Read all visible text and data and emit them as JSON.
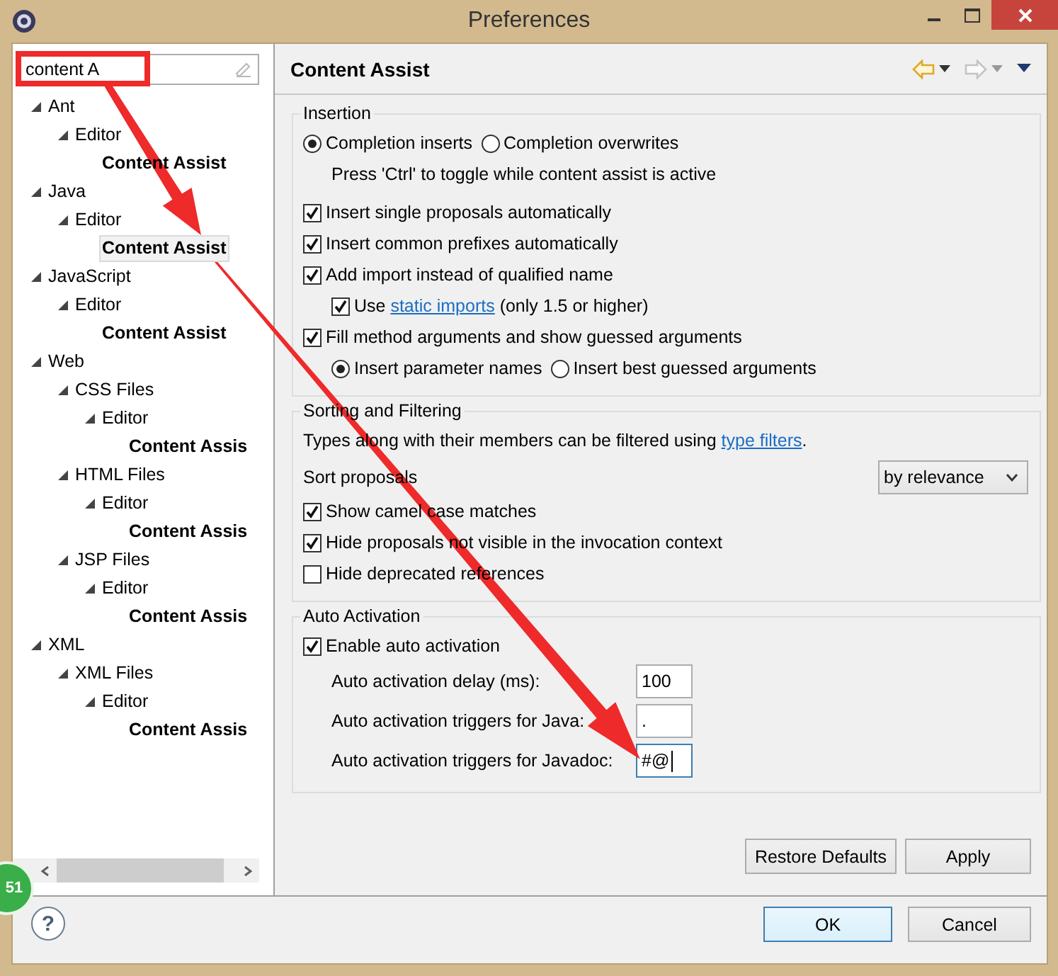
{
  "window": {
    "title": "Preferences"
  },
  "filter": {
    "value": "content A"
  },
  "tree": [
    {
      "label": "Ant",
      "expanded": true,
      "children": [
        {
          "label": "Editor",
          "expanded": true,
          "children": [
            {
              "label": "Content Assist",
              "selected": false
            }
          ]
        }
      ]
    },
    {
      "label": "Java",
      "expanded": true,
      "children": [
        {
          "label": "Editor",
          "expanded": true,
          "children": [
            {
              "label": "Content Assist",
              "selected": true
            }
          ]
        }
      ]
    },
    {
      "label": "JavaScript",
      "expanded": true,
      "children": [
        {
          "label": "Editor",
          "expanded": true,
          "children": [
            {
              "label": "Content Assist",
              "selected": false
            }
          ]
        }
      ]
    },
    {
      "label": "Web",
      "expanded": true,
      "children": [
        {
          "label": "CSS Files",
          "expanded": true,
          "children": [
            {
              "label": "Editor",
              "expanded": true,
              "children": [
                {
                  "label": "Content Assis",
                  "selected": false
                }
              ]
            }
          ]
        },
        {
          "label": "HTML Files",
          "expanded": true,
          "children": [
            {
              "label": "Editor",
              "expanded": true,
              "children": [
                {
                  "label": "Content Assis",
                  "selected": false
                }
              ]
            }
          ]
        },
        {
          "label": "JSP Files",
          "expanded": true,
          "children": [
            {
              "label": "Editor",
              "expanded": true,
              "children": [
                {
                  "label": "Content Assis",
                  "selected": false
                }
              ]
            }
          ]
        }
      ]
    },
    {
      "label": "XML",
      "expanded": true,
      "children": [
        {
          "label": "XML Files",
          "expanded": true,
          "children": [
            {
              "label": "Editor",
              "expanded": true,
              "children": [
                {
                  "label": "Content Assis",
                  "selected": false
                }
              ]
            }
          ]
        }
      ]
    }
  ],
  "page": {
    "title": "Content Assist",
    "back": {
      "enabled": true
    },
    "forward": {
      "enabled": false
    }
  },
  "groups": [
    {
      "title": "Insertion",
      "items": [
        {
          "kind": "radio-group",
          "options": [
            {
              "label": "Completion inserts",
              "selected": true
            },
            {
              "label": "Completion overwrites",
              "selected": false
            }
          ]
        },
        {
          "kind": "note",
          "parts": [
            {
              "text": "Press 'Ctrl' to toggle while content assist is active"
            }
          ]
        },
        {
          "kind": "checkbox",
          "parts": [
            {
              "text": "Insert single proposals automatically"
            }
          ],
          "checked": true
        },
        {
          "kind": "checkbox",
          "parts": [
            {
              "text": "Insert common prefixes automatically"
            }
          ],
          "checked": true
        },
        {
          "kind": "checkbox",
          "parts": [
            {
              "text": "Add import instead of qualified name"
            }
          ],
          "checked": true,
          "children": [
            {
              "kind": "checkbox",
              "parts": [
                {
                  "text": "Use "
                },
                {
                  "link": "static imports"
                },
                {
                  "text": " (only 1.5 or higher)"
                }
              ],
              "checked": true
            }
          ]
        },
        {
          "kind": "checkbox",
          "parts": [
            {
              "text": "Fill method arguments and show guessed arguments"
            }
          ],
          "checked": true,
          "children": [
            {
              "kind": "radio-group",
              "options": [
                {
                  "label": "Insert parameter names",
                  "selected": true
                },
                {
                  "label": "Insert best guessed arguments",
                  "selected": false
                }
              ]
            }
          ]
        }
      ]
    },
    {
      "title": "Sorting and Filtering",
      "items": [
        {
          "kind": "text",
          "parts": [
            {
              "text": "Types along with their members can be filtered using "
            },
            {
              "link": "type filters"
            },
            {
              "text": "."
            }
          ]
        },
        {
          "kind": "select",
          "label": "Sort proposals",
          "value": "by relevance"
        },
        {
          "kind": "checkbox",
          "parts": [
            {
              "text": "Show camel case matches"
            }
          ],
          "checked": true
        },
        {
          "kind": "checkbox",
          "parts": [
            {
              "text": "Hide proposals not visible in the invocation context"
            }
          ],
          "checked": true
        },
        {
          "kind": "checkbox",
          "parts": [
            {
              "text": "Hide deprecated references"
            }
          ],
          "checked": false
        }
      ]
    },
    {
      "title": "Auto Activation",
      "items": [
        {
          "kind": "checkbox",
          "parts": [
            {
              "text": "Enable auto activation"
            }
          ],
          "checked": true
        },
        {
          "kind": "field",
          "label": "Auto activation delay (ms):",
          "value": "100",
          "focused": false
        },
        {
          "kind": "field",
          "label": "Auto activation triggers for Java:",
          "value": ".",
          "focused": false
        },
        {
          "kind": "field",
          "label": "Auto activation triggers for Javadoc:",
          "value": "#@",
          "focused": true
        }
      ]
    }
  ],
  "page_buttons": [
    "Restore Defaults",
    "Apply"
  ],
  "help": {
    "glyph": "?"
  },
  "dialog_buttons": [
    {
      "label": "OK",
      "default": true
    },
    {
      "label": "Cancel",
      "default": false
    }
  ],
  "annotations": [
    {
      "kind": "box"
    },
    {
      "kind": "arrow"
    },
    {
      "kind": "arrow"
    }
  ],
  "badge": {
    "text": "51"
  }
}
